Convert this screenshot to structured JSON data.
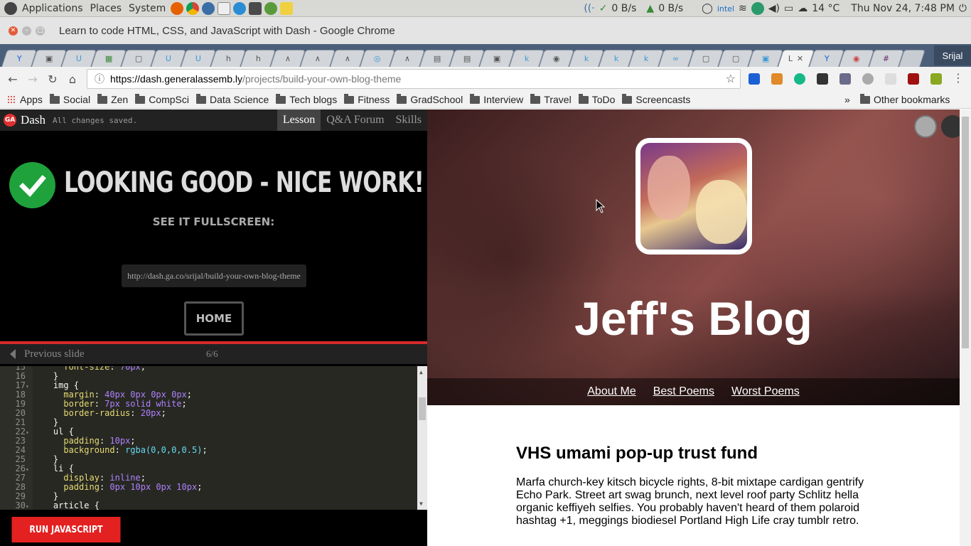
{
  "system": {
    "menus": [
      "Applications",
      "Places",
      "System"
    ],
    "net_down": "0 B/s",
    "net_up": "0 B/s",
    "temperature": "14 °C",
    "datetime": "Thu Nov 24,  7:48 PM"
  },
  "window": {
    "title": "Learn to code HTML, CSS, and JavaScript with Dash - Google Chrome"
  },
  "tabs": {
    "user": "Srijal",
    "active_tab_letter": "L"
  },
  "address": {
    "host": "https://dash.generalassemb.ly",
    "path": "/projects/build-your-own-blog-theme"
  },
  "bookmarks": {
    "apps": "Apps",
    "items": [
      "Social",
      "Zen",
      "CompSci",
      "Data Science",
      "Tech blogs",
      "Fitness",
      "GradSchool",
      "Interview",
      "Travel",
      "ToDo",
      "Screencasts"
    ],
    "more": "»",
    "other": "Other bookmarks"
  },
  "dash": {
    "logo": "GA",
    "brand": "Dash",
    "saved": "All changes saved.",
    "tabs": [
      "Lesson",
      "Q&A Forum",
      "Skills"
    ],
    "success_title": "LOOKING GOOD - NICE WORK!",
    "see_fullscreen": "SEE IT FULLSCREEN:",
    "fullscreen_url": "http://dash.ga.co/srijal/build-your-own-blog-theme",
    "home_button": "HOME",
    "previous_slide": "Previous slide",
    "slide_counter": "6/6",
    "run_button": "RUN JAVASCRIPT"
  },
  "editor": {
    "lines": [
      {
        "n": "15",
        "fold": "",
        "indent": "      ",
        "prop": "font-size",
        "val": "70px",
        "raw": ""
      },
      {
        "n": "16",
        "fold": "",
        "indent": "    ",
        "prop": "",
        "val": "",
        "raw": "}"
      },
      {
        "n": "17",
        "fold": "▾",
        "indent": "    ",
        "prop": "",
        "val": "",
        "raw": "img {"
      },
      {
        "n": "18",
        "fold": "",
        "indent": "      ",
        "prop": "margin",
        "val": "40px 0px 0px 0px",
        "raw": ""
      },
      {
        "n": "19",
        "fold": "",
        "indent": "      ",
        "prop": "border",
        "val": "7px solid white",
        "raw": ""
      },
      {
        "n": "20",
        "fold": "",
        "indent": "      ",
        "prop": "border-radius",
        "val": "20px",
        "raw": ""
      },
      {
        "n": "21",
        "fold": "",
        "indent": "    ",
        "prop": "",
        "val": "",
        "raw": "}"
      },
      {
        "n": "22",
        "fold": "▾",
        "indent": "    ",
        "prop": "",
        "val": "",
        "raw": "ul {"
      },
      {
        "n": "23",
        "fold": "",
        "indent": "      ",
        "prop": "padding",
        "val": "10px",
        "raw": ""
      },
      {
        "n": "24",
        "fold": "",
        "indent": "      ",
        "prop": "background",
        "val": "rgba(0,0,0,0.5)",
        "raw": ""
      },
      {
        "n": "25",
        "fold": "",
        "indent": "    ",
        "prop": "",
        "val": "",
        "raw": "}"
      },
      {
        "n": "26",
        "fold": "▾",
        "indent": "    ",
        "prop": "",
        "val": "",
        "raw": "li {"
      },
      {
        "n": "27",
        "fold": "",
        "indent": "      ",
        "prop": "display",
        "val": "inline",
        "raw": ""
      },
      {
        "n": "28",
        "fold": "",
        "indent": "      ",
        "prop": "padding",
        "val": "0px 10px 0px 10px",
        "raw": ""
      },
      {
        "n": "29",
        "fold": "",
        "indent": "    ",
        "prop": "",
        "val": "",
        "raw": "}"
      },
      {
        "n": "30",
        "fold": "▾",
        "indent": "    ",
        "prop": "",
        "val": "",
        "raw": "article {"
      }
    ]
  },
  "blog": {
    "title": "Jeff's Blog",
    "nav": [
      "About Me",
      "Best Poems",
      "Worst Poems"
    ],
    "article_title": "VHS umami pop-up trust fund",
    "article_text": "Marfa church-key kitsch bicycle rights, 8-bit mixtape cardigan gentrify Echo Park. Street art swag brunch, next level roof party Schlitz hella organic keffiyeh selfies. You probably haven't heard of them polaroid hashtag +1, meggings biodiesel Portland High Life cray tumblr retro."
  },
  "colors": {
    "accent_red": "#e32121",
    "success_green": "#1fa23c",
    "editor_bg": "#272822"
  }
}
